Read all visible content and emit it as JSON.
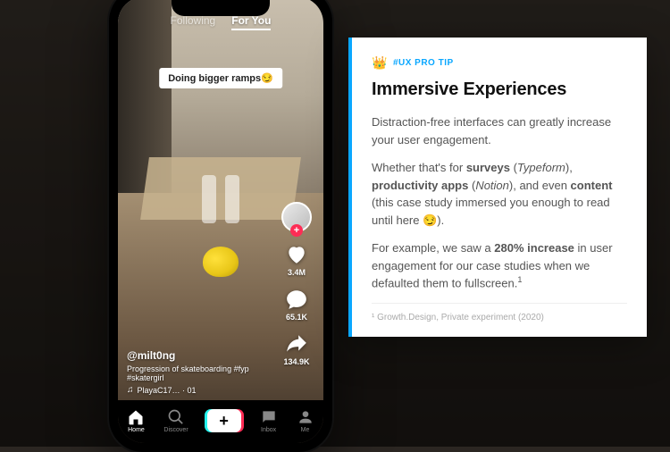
{
  "phone": {
    "feed_tabs": {
      "following": "Following",
      "for_you": "For You"
    },
    "caption_chip": "Doing bigger ramps😏",
    "rail": {
      "likes": "3.4M",
      "comments": "65.1K",
      "shares": "134.9K"
    },
    "meta": {
      "user": "@milt0ng",
      "desc": "Progression of skateboarding #fyp #skatergirl",
      "sound": "PlayaC17…  · 01"
    },
    "tabs": {
      "home": "Home",
      "discover": "Discover",
      "inbox": "Inbox",
      "me": "Me"
    }
  },
  "tip": {
    "kicker": "#UX PRO TIP",
    "title": "Immersive Experiences",
    "p1a": "Distraction-free interfaces can greatly increase your user engagement.",
    "p2_pre": "Whether that's for ",
    "p2_b1": "surveys",
    "p2_i1": "Typeform",
    "p2_mid1": "), ",
    "p2_b2": "productivity apps",
    "p2_i2": "Notion",
    "p2_mid2": "), and even ",
    "p2_b3": "content",
    "p2_post": " (this case study immersed you enough to read until here 😏).",
    "p3_pre": "For example, we saw a ",
    "p3_b": "280% increase",
    "p3_post": " in user engagement for our case studies when we defaulted them to fullscreen.",
    "ref": "¹ Growth.Design, Private experiment (2020)"
  }
}
